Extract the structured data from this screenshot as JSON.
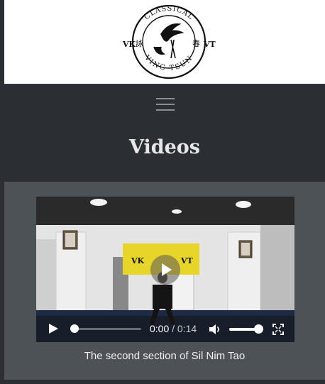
{
  "logo": {
    "top_text": "CLASSICAL",
    "bottom_text": "VING TSUN",
    "left_text": "VK",
    "right_text": "VT",
    "left_glyph": "詠",
    "right_glyph": "春"
  },
  "nav": {
    "menu_icon": "hamburger-icon"
  },
  "page": {
    "title": "Videos"
  },
  "video": {
    "banner_left": "VK",
    "banner_right": "VT",
    "current_time": "0:00",
    "separator": "/",
    "duration": "0:14",
    "progress_fraction": 0.0,
    "volume_fraction": 1.0,
    "caption": "The second section of Sil Nim Tao"
  },
  "colors": {
    "header_bg": "#2b2f33",
    "content_bg": "#4c5256",
    "banner_yellow": "#e8d52a"
  }
}
